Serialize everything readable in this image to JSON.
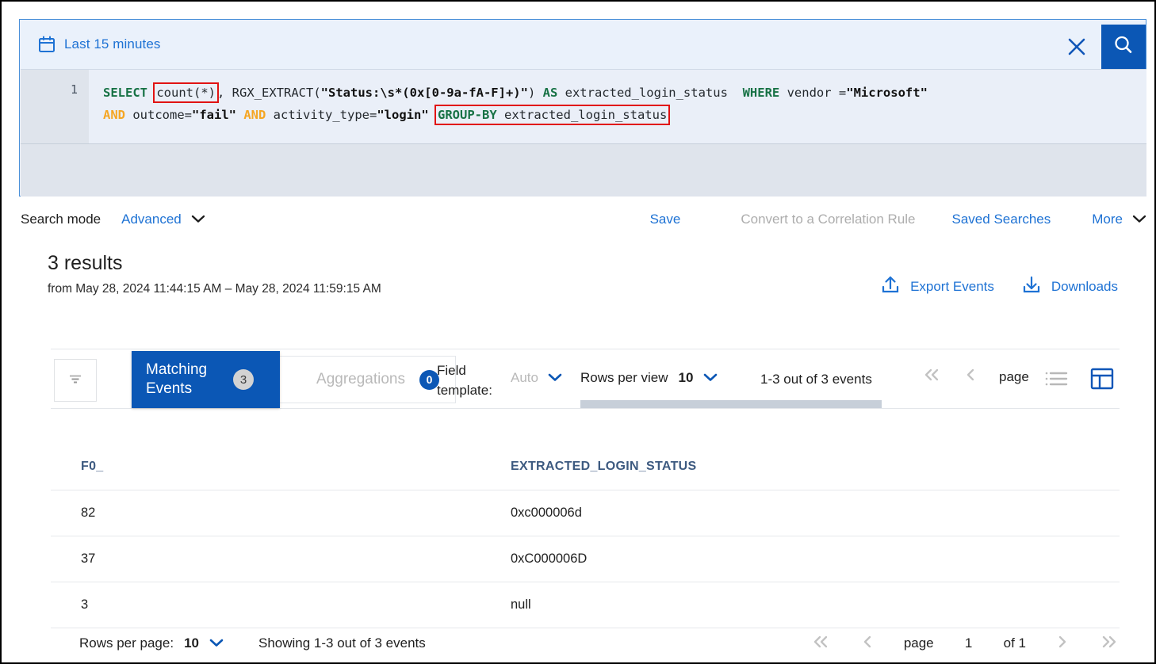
{
  "search_panel": {
    "time_range_label": "Last 15 minutes",
    "calendar_icon": "calendar-icon",
    "close_icon": "close-icon",
    "search_icon": "search-icon",
    "editor": {
      "line_number": "1",
      "tokens_line1": {
        "t1": "SELECT",
        "t2": "count(*)",
        "t3": ", RGX_EXTRACT(",
        "t4": "\"Status:\\s*(0x[0-9a-fA-F]+)\"",
        "t5": ") ",
        "t6": "AS",
        "t7": " extracted_login_status  ",
        "t8": "WHERE",
        "t9": " vendor =",
        "t10": "\"Microsoft\""
      },
      "tokens_line2": {
        "t1": "AND",
        "t2": " outcome=",
        "t3": "\"fail\"",
        "t4": " ",
        "t5": "AND",
        "t6": " activity_type=",
        "t7": "\"login\"",
        "t8": " ",
        "t9": "GROUP-BY",
        "t10": " extracted_login_status"
      }
    }
  },
  "mode_row": {
    "label": "Search mode",
    "value": "Advanced",
    "save_label": "Save",
    "convert_label": "Convert to a Correlation Rule",
    "saved_searches_label": "Saved Searches",
    "more_label": "More"
  },
  "results": {
    "count_text": "3 results",
    "range_text": "from May 28, 2024 11:44:15 AM – May 28, 2024 11:59:15 AM",
    "export_label": "Export Events",
    "downloads_label": "Downloads"
  },
  "toolbar": {
    "filter_icon": "filter-icon",
    "tab_matching_label": "Matching Events",
    "tab_matching_badge": "3",
    "tab_aggregations_label": "Aggregations",
    "tab_aggregations_badge": "0",
    "field_template_label": "Field template:",
    "field_template_value": "Auto",
    "rows_per_view_label": "Rows per view",
    "rows_per_view_value": "10",
    "events_range_text": "1-3 out of 3 events",
    "page_text": "page",
    "list_icon": "list-icon",
    "table_layout_icon": "table-layout-icon"
  },
  "table": {
    "columns": [
      "F0_",
      "EXTRACTED_LOGIN_STATUS"
    ],
    "rows": [
      {
        "f0": "82",
        "status": "0xc000006d"
      },
      {
        "f0": "37",
        "status": "0xC000006D"
      },
      {
        "f0": "3",
        "status": "null"
      }
    ]
  },
  "footer": {
    "rows_per_page_label": "Rows per page:",
    "rows_per_page_value": "10",
    "showing_text": "Showing 1-3 out of 3 events",
    "page_label": "page",
    "page_number": "1",
    "of_pages": "of 1"
  },
  "colors": {
    "accent_blue": "#0b57b5",
    "link_blue": "#1e72d4",
    "panel_bg": "#eaf1fb",
    "highlight_red": "#e11313",
    "keyword_green": "#177245",
    "keyword_orange": "#f5a623"
  }
}
